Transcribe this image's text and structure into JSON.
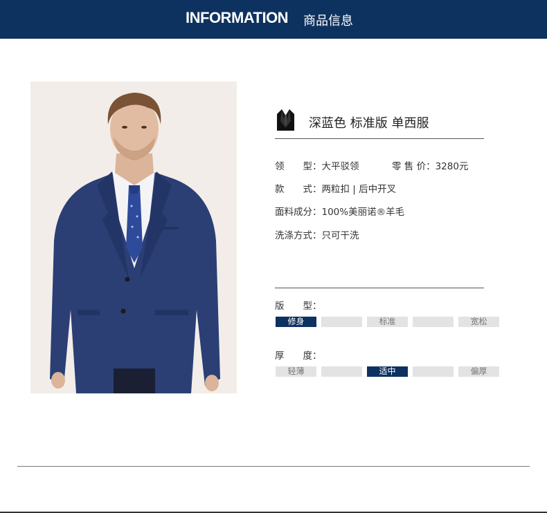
{
  "header": {
    "title_en": "INFORMATION",
    "title_cn": "商品信息"
  },
  "product": {
    "image_icon": "suit-model-photo",
    "title_icon": "suit-icon",
    "title": "深蓝色 标准版 单西服"
  },
  "specs": [
    {
      "label": "领　　型：",
      "value": "大平驳领"
    },
    {
      "label": "款　　式：",
      "value": "两粒扣 | 后中开叉"
    },
    {
      "label": "面料成分：",
      "value": "100%美丽诺®羊毛"
    },
    {
      "label": "洗涤方式：",
      "value": "只可干洗"
    }
  ],
  "price": {
    "label": "零 售 价：",
    "value": "3280元"
  },
  "fit": {
    "label": "版　　型：",
    "options": [
      "修身",
      "",
      "标准",
      "",
      "宽松"
    ],
    "selected_index": 0
  },
  "thickness": {
    "label": "厚　　度：",
    "options": [
      "轻薄",
      "",
      "适中",
      "",
      "偏厚"
    ],
    "selected_index": 2
  },
  "colors": {
    "header_bg": "#0e3260",
    "active_cell": "#0e3260",
    "inactive_cell": "#e3e3e3"
  }
}
